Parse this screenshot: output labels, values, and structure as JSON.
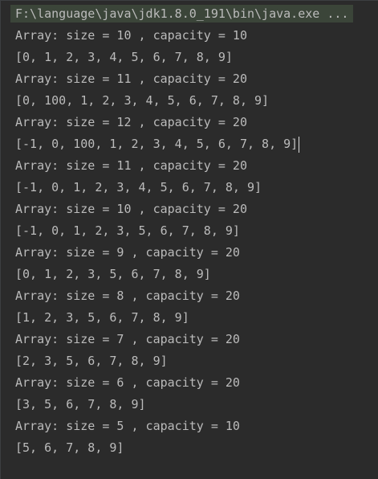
{
  "console": {
    "command": "F:\\language\\java\\jdk1.8.0_191\\bin\\java.exe ...",
    "lines": [
      "Array: size = 10 , capacity = 10",
      "[0, 1, 2, 3, 4, 5, 6, 7, 8, 9]",
      "Array: size = 11 , capacity = 20",
      "[0, 100, 1, 2, 3, 4, 5, 6, 7, 8, 9]",
      "Array: size = 12 , capacity = 20",
      "[-1, 0, 100, 1, 2, 3, 4, 5, 6, 7, 8, 9]",
      "Array: size = 11 , capacity = 20",
      "[-1, 0, 1, 2, 3, 4, 5, 6, 7, 8, 9]",
      "Array: size = 10 , capacity = 20",
      "[-1, 0, 1, 2, 3, 5, 6, 7, 8, 9]",
      "Array: size = 9 , capacity = 20",
      "[0, 1, 2, 3, 5, 6, 7, 8, 9]",
      "Array: size = 8 , capacity = 20",
      "[1, 2, 3, 5, 6, 7, 8, 9]",
      "Array: size = 7 , capacity = 20",
      "[2, 3, 5, 6, 7, 8, 9]",
      "Array: size = 6 , capacity = 20",
      "[3, 5, 6, 7, 8, 9]",
      "Array: size = 5 , capacity = 10",
      "[5, 6, 7, 8, 9]"
    ]
  }
}
